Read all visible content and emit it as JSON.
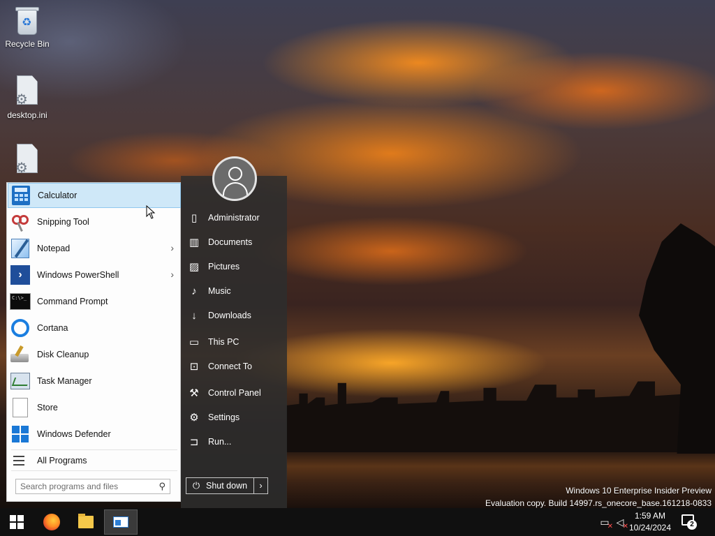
{
  "desktop": {
    "icons": [
      {
        "label": "Recycle Bin",
        "icon": "recycle-bin-icon"
      },
      {
        "label": "desktop.ini",
        "icon": "settings-file-icon"
      },
      {
        "label": "",
        "icon": "settings-file-icon"
      }
    ]
  },
  "start_menu": {
    "programs": [
      {
        "label": "Calculator",
        "icon": "calculator-icon",
        "selected": true,
        "has_submenu": false
      },
      {
        "label": "Snipping Tool",
        "icon": "snipping-tool-icon",
        "has_submenu": false
      },
      {
        "label": "Notepad",
        "icon": "notepad-icon",
        "has_submenu": true
      },
      {
        "label": "Windows PowerShell",
        "icon": "powershell-icon",
        "has_submenu": true
      },
      {
        "label": "Command Prompt",
        "icon": "command-prompt-icon",
        "has_submenu": false
      },
      {
        "label": "Cortana",
        "icon": "cortana-icon",
        "has_submenu": false
      },
      {
        "label": "Disk Cleanup",
        "icon": "disk-cleanup-icon",
        "has_submenu": false
      },
      {
        "label": "Task Manager",
        "icon": "task-manager-icon",
        "has_submenu": false
      },
      {
        "label": "Store",
        "icon": "store-icon",
        "has_submenu": false
      },
      {
        "label": "Windows Defender",
        "icon": "windows-defender-icon",
        "has_submenu": false
      }
    ],
    "all_programs_label": "All Programs",
    "search_placeholder": "Search programs and files",
    "submenu_arrow": "›",
    "user": {
      "name": "Administrator"
    },
    "places": [
      {
        "label": "Administrator",
        "icon": "user-folder-icon"
      },
      {
        "label": "Documents",
        "icon": "documents-icon"
      },
      {
        "label": "Pictures",
        "icon": "pictures-icon"
      },
      {
        "label": "Music",
        "icon": "music-icon"
      },
      {
        "label": "Downloads",
        "icon": "downloads-icon"
      },
      {
        "label": "This PC",
        "icon": "this-pc-icon"
      },
      {
        "label": "Connect To",
        "icon": "connect-to-icon"
      },
      {
        "label": "Control Panel",
        "icon": "control-panel-icon"
      },
      {
        "label": "Settings",
        "icon": "settings-icon"
      },
      {
        "label": "Run...",
        "icon": "run-icon"
      }
    ],
    "shutdown_label": "Shut down"
  },
  "watermark": {
    "line1": "Windows 10 Enterprise Insider Preview",
    "line2": "Evaluation copy. Build 14997.rs_onecore_base.161218-0833"
  },
  "taskbar": {
    "pinned": [
      "start-icon",
      "firefox-icon",
      "file-explorer-icon",
      "active-window-icon"
    ],
    "clock": {
      "time": "1:59 AM",
      "date": "10/24/2024"
    },
    "notifications_count": "2"
  },
  "colors": {
    "selection_bg": "#cfe8f8",
    "selection_border": "#8fc7ee",
    "accent_blue": "#1a78d6",
    "right_panel_bg": "#2d2d2d",
    "taskbar_bg": "#101010"
  }
}
